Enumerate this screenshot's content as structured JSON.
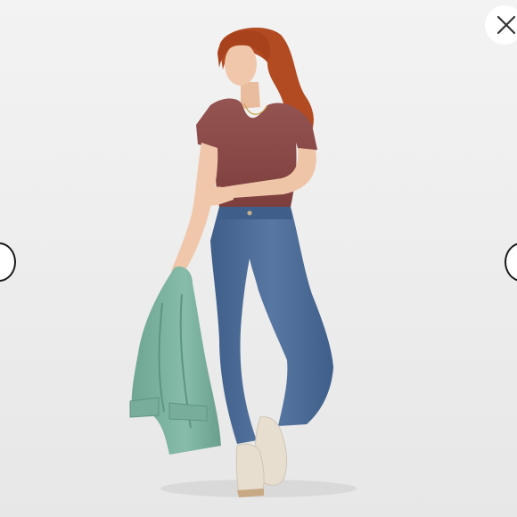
{
  "viewer": {
    "background_color": "#ededed",
    "image_subject": "product-photo-woman-jeans"
  },
  "controls": {
    "close_icon": "close-x-icon",
    "prev_icon": "arrow-left-icon",
    "next_icon": "arrow-right-icon"
  },
  "colors": {
    "shirt": "#8c4a47",
    "jeans": "#4e6f98",
    "jacket": "#7fb3a0",
    "hair": "#b24a22",
    "skin": "#f0c7aa",
    "sneakers": "#e7ded0"
  }
}
